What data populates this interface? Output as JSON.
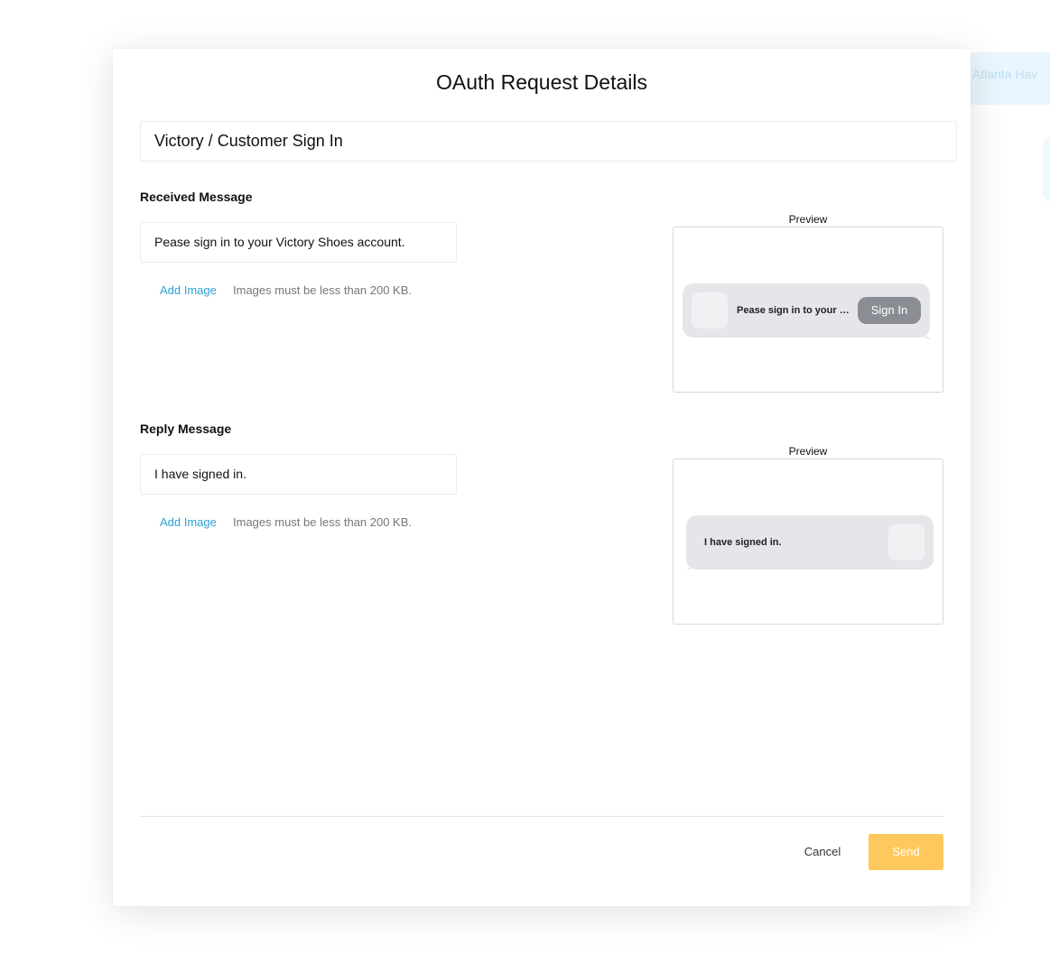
{
  "background": {
    "banner_text": "e Atlanta Hav"
  },
  "modal": {
    "title": "OAuth Request Details",
    "name_value": "Victory / Customer Sign In"
  },
  "received": {
    "label": "Received Message",
    "message": "Pease sign in to your Victory Shoes account.",
    "add_image": "Add Image",
    "image_hint": "Images must be less than 200 KB.",
    "preview_label": "Preview",
    "preview_text": "Pease sign in to your Victory Shoes account.",
    "preview_button": "Sign In"
  },
  "reply": {
    "label": "Reply Message",
    "message": "I have signed in.",
    "add_image": "Add Image",
    "image_hint": "Images must be less than 200 KB.",
    "preview_label": "Preview",
    "preview_text": "I have signed in."
  },
  "footer": {
    "cancel_label": "Cancel",
    "send_label": "Send"
  },
  "colors": {
    "accent_link": "#2ea3d6",
    "send_button": "#ffc85c",
    "bubble": "#e6e6ea",
    "signin_button": "#8a8d93"
  }
}
